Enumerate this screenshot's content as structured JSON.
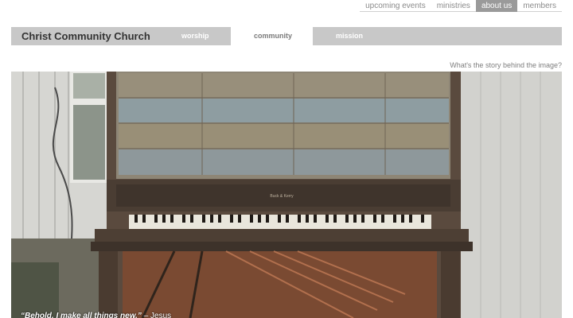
{
  "top_nav": [
    "upcoming events",
    "ministries",
    "about us",
    "members"
  ],
  "brand": "Christ Community Church",
  "main_nav": {
    "worship": "worship",
    "community": "community",
    "mission": "mission"
  },
  "story_link": "What's the story behind the image?",
  "hero": {
    "piano_label": "Buck & Kerry",
    "caption_quote": "“Behold, I make all things new.”",
    "caption_author": " – Jesus"
  }
}
